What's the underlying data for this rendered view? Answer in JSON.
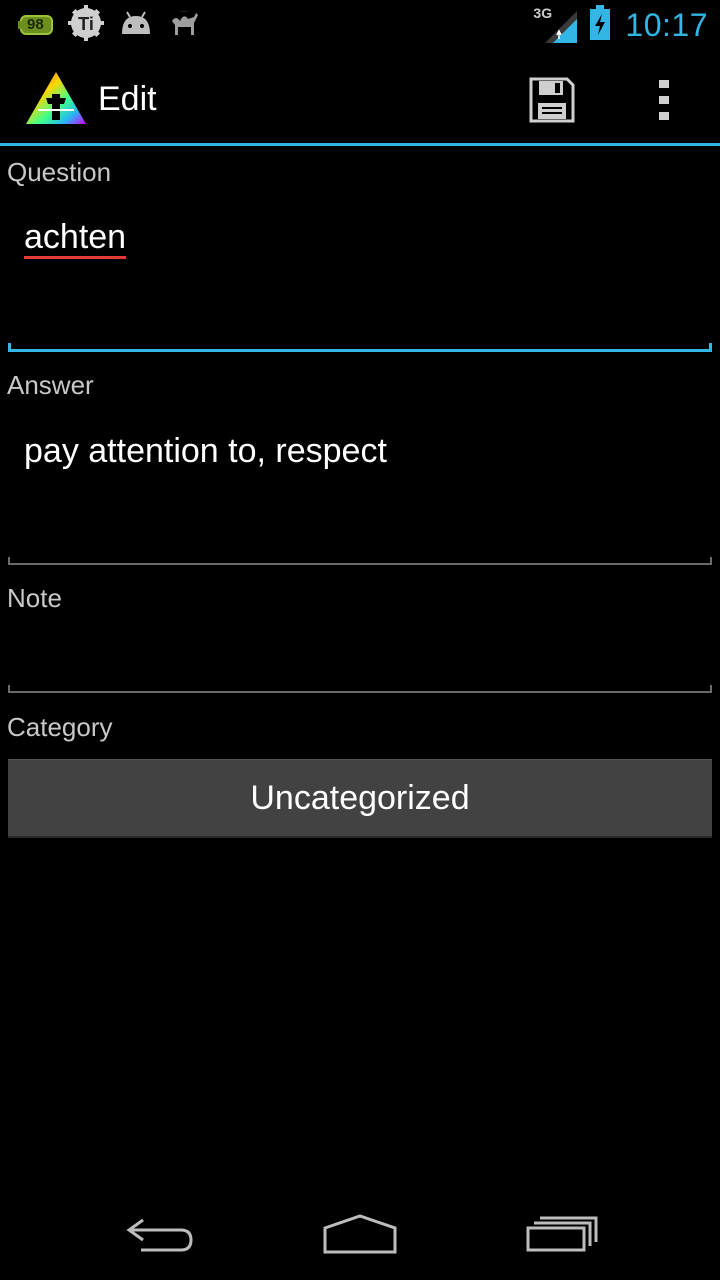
{
  "status_bar": {
    "battery_badge": "98",
    "network_type": "3G",
    "time": "10:17"
  },
  "action_bar": {
    "title": "Edit",
    "save_icon": "save-icon",
    "overflow_icon": "overflow-menu-icon"
  },
  "form": {
    "question_label": "Question",
    "question_value": "achten",
    "answer_label": "Answer",
    "answer_value": "pay attention to, respect",
    "note_label": "Note",
    "note_value": "",
    "category_label": "Category",
    "category_value": "Uncategorized"
  },
  "nav": {
    "back_icon": "back-icon",
    "home_icon": "home-icon",
    "recents_icon": "recents-icon"
  },
  "colors": {
    "accent": "#33b5e5",
    "background": "#000000",
    "button": "#424242",
    "spellcheck": "#e53935"
  }
}
